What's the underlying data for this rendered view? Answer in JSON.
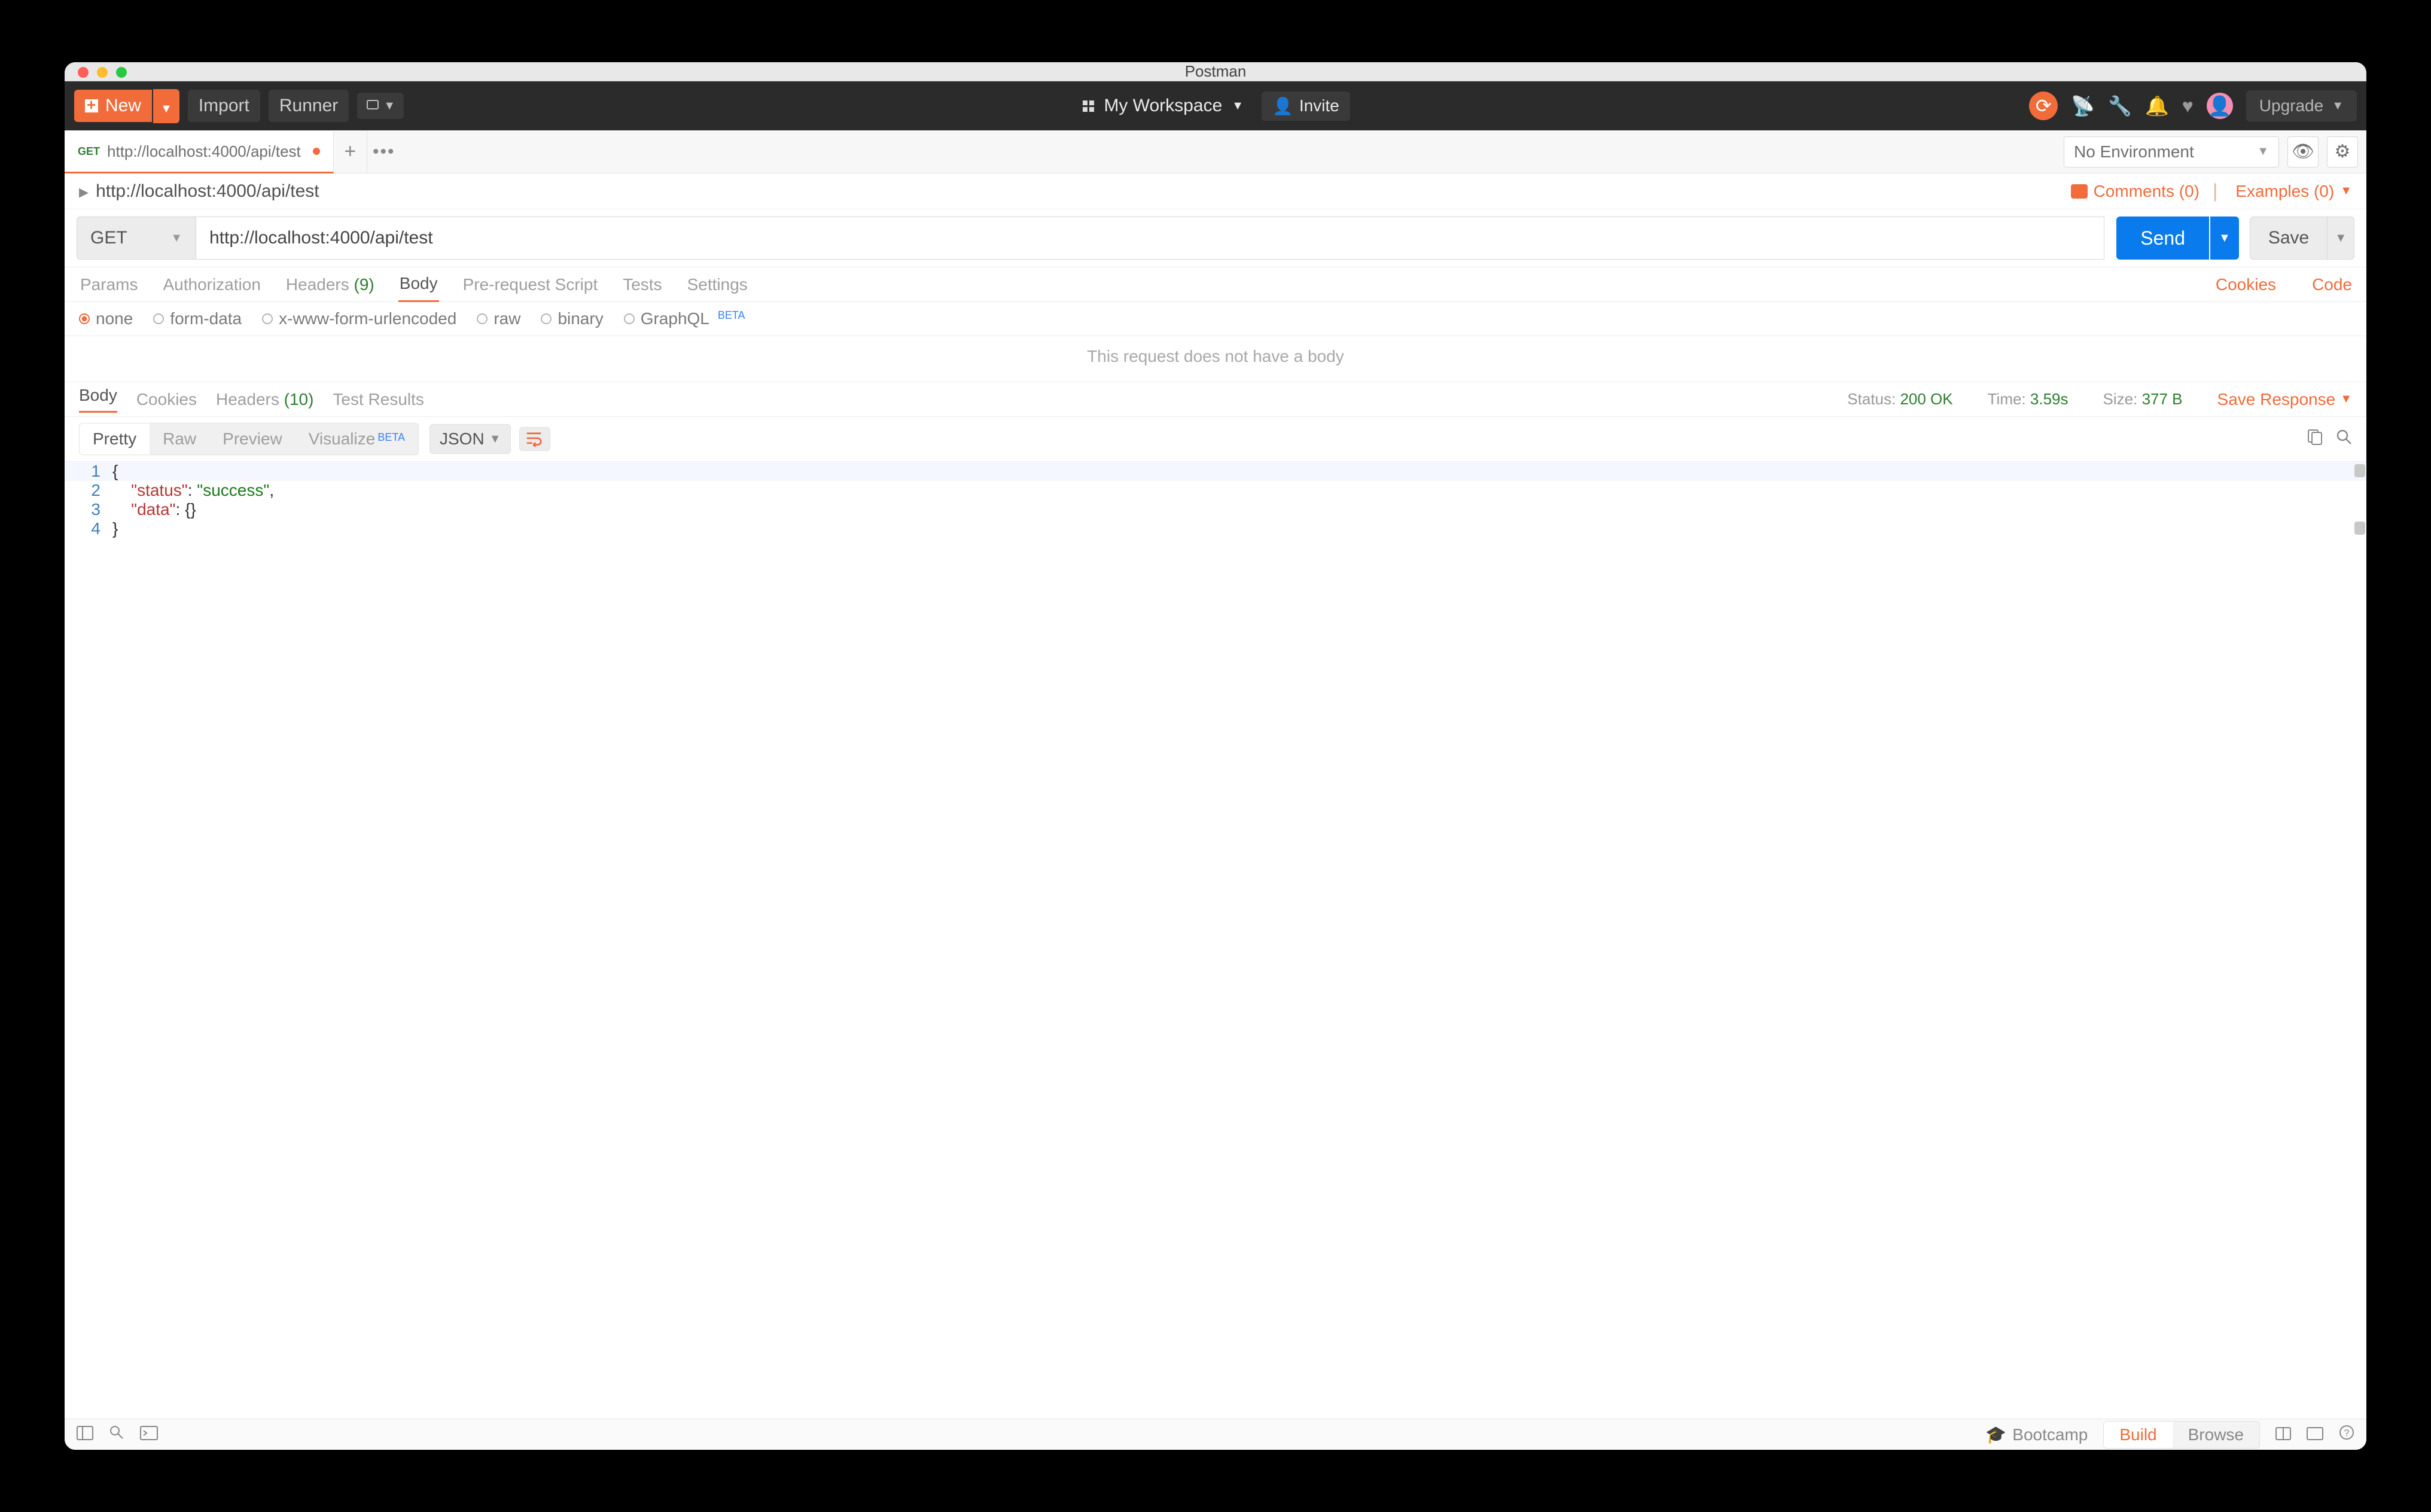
{
  "window": {
    "title": "Postman"
  },
  "topbar": {
    "new": "New",
    "import": "Import",
    "runner": "Runner",
    "workspace": "My Workspace",
    "invite": "Invite",
    "upgrade": "Upgrade"
  },
  "tabs": {
    "open": {
      "method": "GET",
      "title": "http://localhost:4000/api/test"
    }
  },
  "environment": {
    "selected": "No Environment"
  },
  "request": {
    "name": "http://localhost:4000/api/test",
    "comments": "Comments (0)",
    "examples": "Examples (0)",
    "method": "GET",
    "url": "http://localhost:4000/api/test",
    "send": "Send",
    "save": "Save"
  },
  "request_tabs": {
    "params": "Params",
    "authorization": "Authorization",
    "headers": "Headers",
    "headers_count": "(9)",
    "body": "Body",
    "prerequest": "Pre-request Script",
    "tests": "Tests",
    "settings": "Settings",
    "cookies": "Cookies",
    "code": "Code"
  },
  "body_types": {
    "none": "none",
    "formdata": "form-data",
    "xwww": "x-www-form-urlencoded",
    "raw": "raw",
    "binary": "binary",
    "graphql": "GraphQL",
    "beta": "BETA",
    "empty_msg": "This request does not have a body"
  },
  "response_tabs": {
    "body": "Body",
    "cookies": "Cookies",
    "headers": "Headers",
    "headers_count": "(10)",
    "test_results": "Test Results"
  },
  "response_status": {
    "status_label": "Status:",
    "status_value": "200 OK",
    "time_label": "Time:",
    "time_value": "3.59s",
    "size_label": "Size:",
    "size_value": "377 B",
    "save_response": "Save Response"
  },
  "pretty": {
    "pretty": "Pretty",
    "raw": "Raw",
    "preview": "Preview",
    "visualize": "Visualize",
    "beta": "BETA",
    "lang": "JSON"
  },
  "response_body": {
    "l1": "{",
    "l2_key": "\"status\"",
    "l2_val": "\"success\"",
    "l3_key": "\"data\"",
    "l3_val": "{}",
    "l4": "}"
  },
  "statusbar": {
    "bootcamp": "Bootcamp",
    "build": "Build",
    "browse": "Browse"
  }
}
